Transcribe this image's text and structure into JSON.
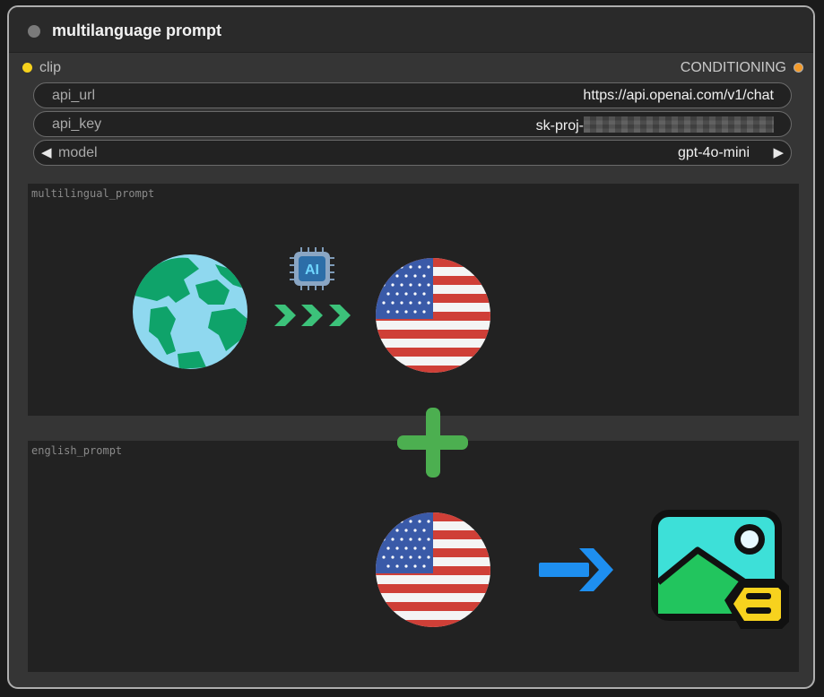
{
  "node": {
    "title": "multilanguage prompt",
    "input_slot": "clip",
    "output_slot": "CONDITIONING"
  },
  "widgets": {
    "api_url": {
      "label": "api_url",
      "value": "https://api.openai.com/v1/chat"
    },
    "api_key": {
      "label": "api_key",
      "value": "sk-proj-"
    },
    "model": {
      "label": "model",
      "value": "gpt-4o-mini"
    }
  },
  "textareas": {
    "multilingual": {
      "label": "multilingual_prompt"
    },
    "english": {
      "label": "english_prompt"
    }
  },
  "illustration": {
    "chip_text": "AI"
  },
  "colors": {
    "input_dot": "#f6d21d",
    "output_dot": "#f39a2a",
    "chevrons": "#3cc27a",
    "plus": "#4caf50",
    "blue_arrow": "#1e8ff0"
  }
}
